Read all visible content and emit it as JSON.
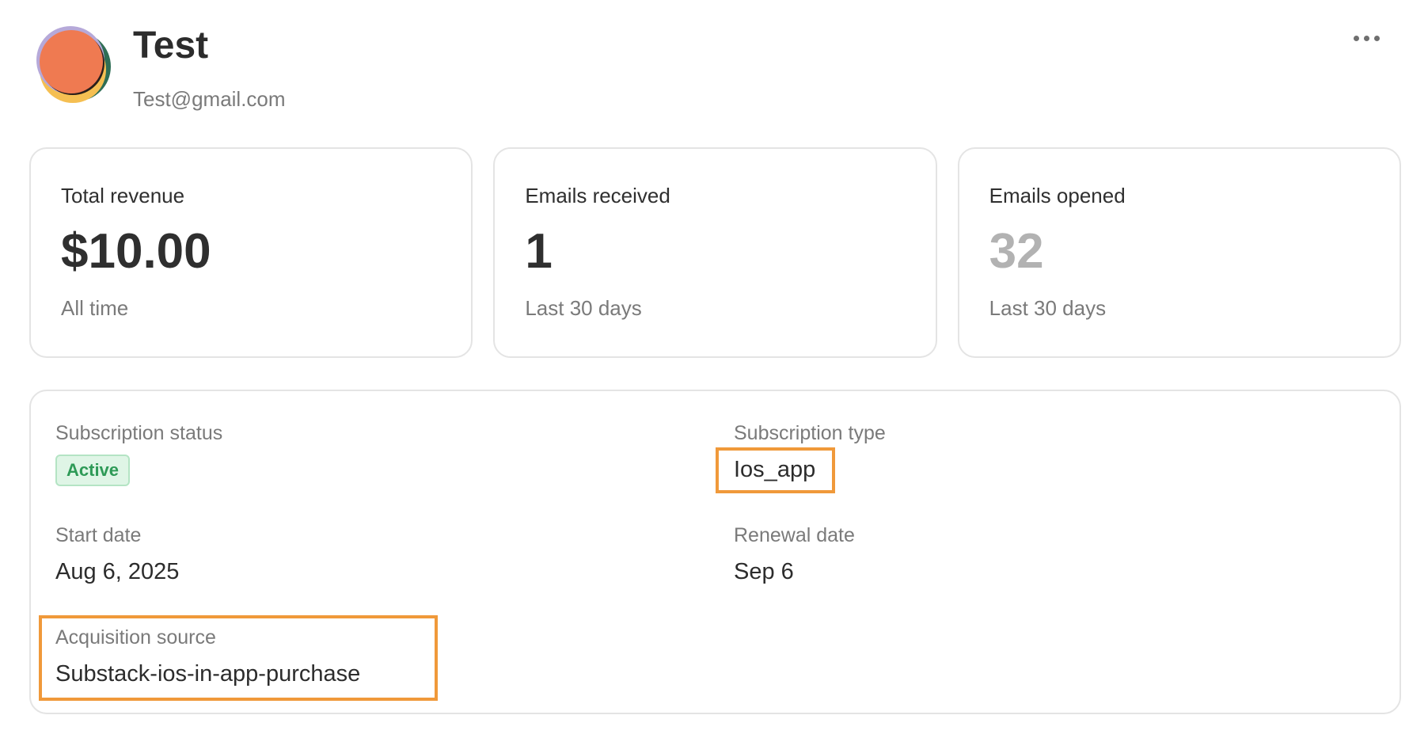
{
  "profile": {
    "name": "Test",
    "email": "Test@gmail.com"
  },
  "header": {
    "more_icon": "more-horizontal-icon"
  },
  "stats": [
    {
      "label": "Total revenue",
      "value": "$10.00",
      "sub": "All time"
    },
    {
      "label": "Emails received",
      "value": "1",
      "sub": "Last 30 days"
    },
    {
      "label": "Emails opened",
      "value": "32",
      "sub": "Last 30 days"
    }
  ],
  "details": {
    "subscription_status": {
      "label": "Subscription status",
      "value": "Active"
    },
    "subscription_type": {
      "label": "Subscription type",
      "value": "Ios_app"
    },
    "start_date": {
      "label": "Start date",
      "value": "Aug 6, 2025"
    },
    "renewal_date": {
      "label": "Renewal date",
      "value": "Sep 6"
    },
    "acquisition_source": {
      "label": "Acquisition source",
      "value": "Substack-ios-in-app-purchase"
    }
  },
  "colors": {
    "highlight": "#f0993a",
    "badge_text": "#2e9a57",
    "badge_bg": "#dff5e6",
    "muted_value": "#b2b2b2"
  }
}
